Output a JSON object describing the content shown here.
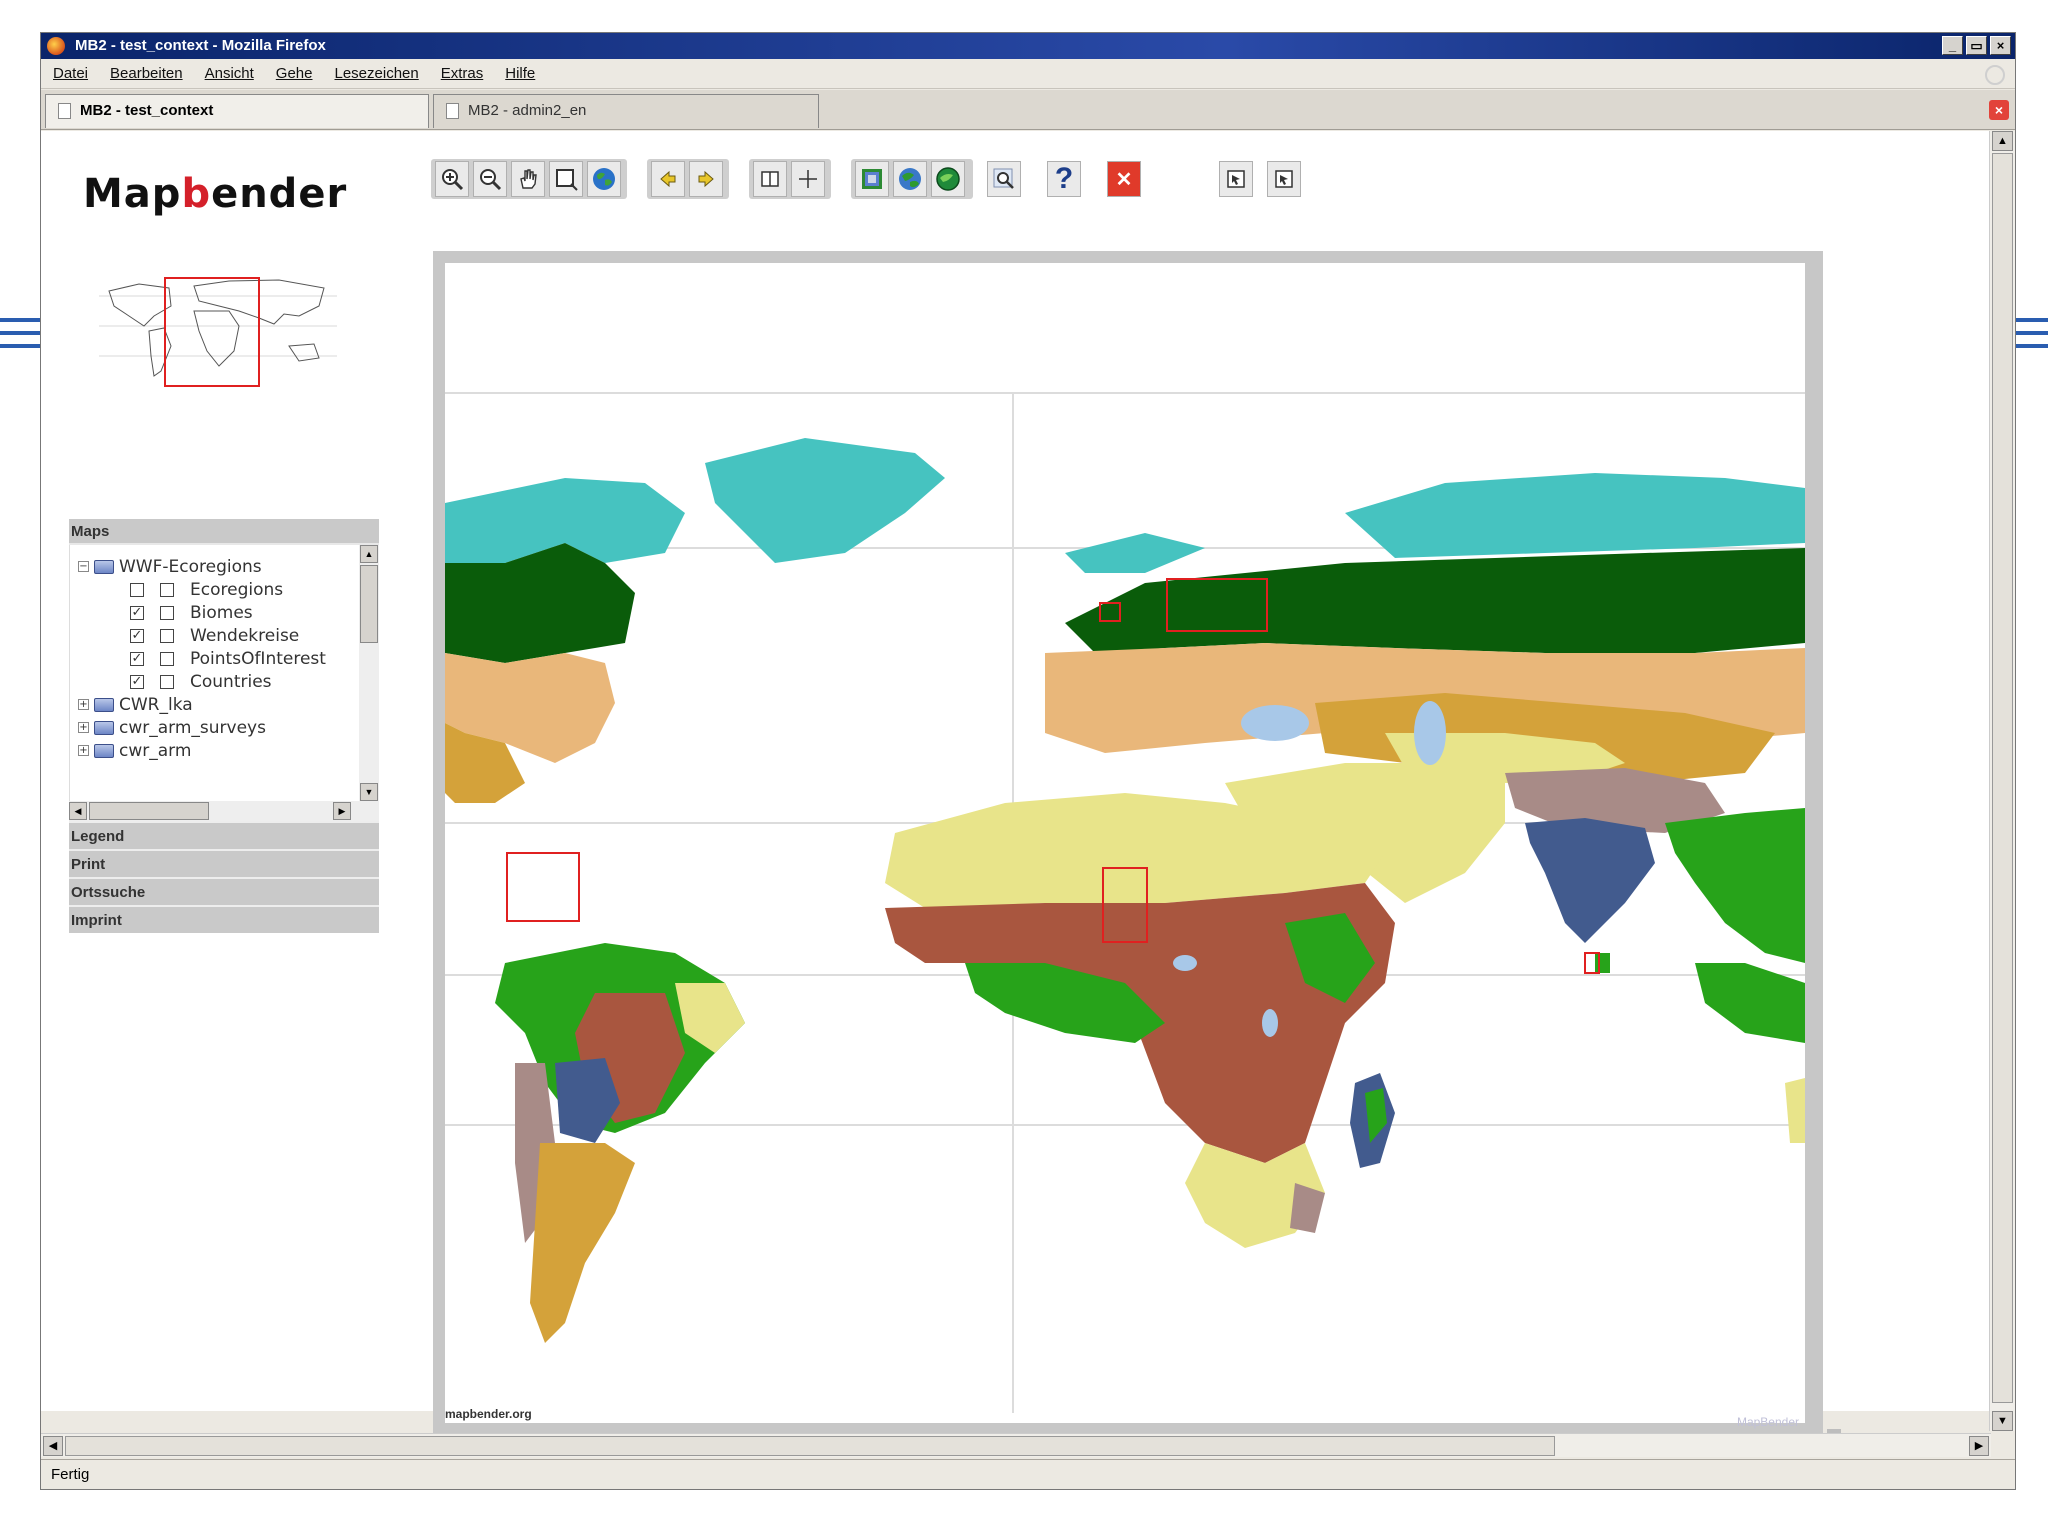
{
  "window": {
    "title": "MB2 - test_context - Mozilla Firefox",
    "controls": [
      "_",
      "▭",
      "×"
    ]
  },
  "menu": [
    "Datei",
    "Bearbeiten",
    "Ansicht",
    "Gehe",
    "Lesezeichen",
    "Extras",
    "Hilfe"
  ],
  "tabs": [
    {
      "label": "MB2 - test_context",
      "active": true
    },
    {
      "label": "MB2 - admin2_en",
      "active": false
    }
  ],
  "tab_close_glyph": "×",
  "app": {
    "logo": {
      "pre": "Map",
      "accent": "b",
      "post": "ender",
      "accent_color": "#d4202a"
    }
  },
  "toolbar": {
    "icons": [
      "zoom-in-icon",
      "zoom-out-icon",
      "pan-hand-icon",
      "zoom-box-icon",
      "full-extent-globe-icon",
      "back-arrow-icon",
      "forward-arrow-icon",
      "select-icon",
      "coordinates-icon",
      "load-wms-icon",
      "layer-globe-icon",
      "wms-globe-icon",
      "search-icon",
      "help-icon",
      "close-icon",
      "export-icon",
      "export-alt-icon"
    ],
    "help_glyph": "?",
    "close_glyph": "✕"
  },
  "layer_panel": {
    "header": "Maps",
    "tree": [
      {
        "label": "WWF-Ecoregions",
        "type": "folder",
        "expander": "−",
        "level": 0
      },
      {
        "label": "Ecoregions",
        "type": "layer",
        "checked_a": false,
        "checked_b": false,
        "level": 1
      },
      {
        "label": "Biomes",
        "type": "layer",
        "checked_a": true,
        "checked_b": false,
        "level": 1
      },
      {
        "label": "Wendekreise",
        "type": "layer",
        "checked_a": true,
        "checked_b": false,
        "level": 1
      },
      {
        "label": "PointsOfInterest",
        "type": "layer",
        "checked_a": true,
        "checked_b": false,
        "level": 1
      },
      {
        "label": "Countries",
        "type": "layer",
        "checked_a": true,
        "checked_b": false,
        "level": 1
      },
      {
        "label": "CWR_lka",
        "type": "folder",
        "expander": "+",
        "level": 0
      },
      {
        "label": "cwr_arm_surveys",
        "type": "folder",
        "expander": "+",
        "level": 0
      },
      {
        "label": "cwr_arm",
        "type": "folder",
        "expander": "+",
        "level": 0
      }
    ]
  },
  "collapsed_panels": [
    "Legend",
    "Print",
    "Ortssuche",
    "Imprint"
  ],
  "map": {
    "credit": "mapbender.org",
    "watermark": "MapBender",
    "colors": {
      "tundra": "#46c3c0",
      "boreal": "#0a5c0a",
      "temperate": "#e9b77a",
      "grassland": "#d4a23a",
      "desert": "#e8e48a",
      "savanna": "#a9563f",
      "tropical": "#27a31a",
      "mountain": "#a88b87",
      "flooded": "#425b8e",
      "lake": "#a8c8e8",
      "highlight": "#e02020"
    }
  },
  "statusbar": {
    "text": "Fertig"
  }
}
